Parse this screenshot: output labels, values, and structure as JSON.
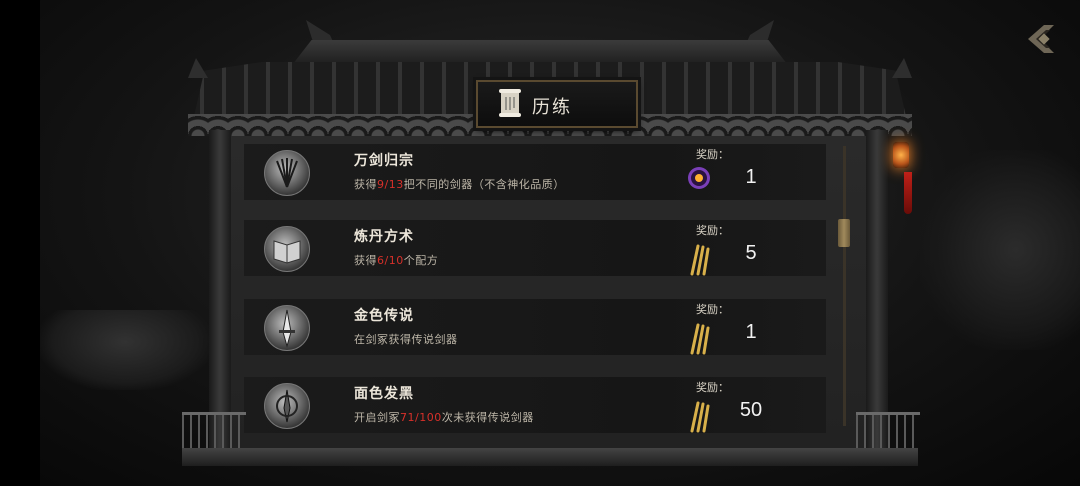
{
  "header": {
    "title": "历练"
  },
  "rewards_label": "奖励：",
  "achievements": [
    {
      "name": "万剑归宗",
      "desc_pre": "获得",
      "desc_hl": "9/13",
      "desc_post": "把不同的剑器（不含神化品质）",
      "reward_icon": "purple-orb-icon",
      "reward_amount": "1"
    },
    {
      "name": "炼丹方术",
      "desc_pre": "获得",
      "desc_hl": "6/10",
      "desc_post": "个配方",
      "reward_icon": "gold-swords-icon",
      "reward_amount": "5"
    },
    {
      "name": "金色传说",
      "desc_pre": "在剑冢获得传说剑器",
      "desc_hl": "",
      "desc_post": "",
      "reward_icon": "gold-swords-icon",
      "reward_amount": "1"
    },
    {
      "name": "面色发黑",
      "desc_pre": "开启剑冢",
      "desc_hl": "71/100",
      "desc_post": "次未获得传说剑器",
      "reward_icon": "gold-swords-icon",
      "reward_amount": "50"
    }
  ],
  "colors": {
    "highlight": "#d6302a",
    "gold": "#c9a44a",
    "panel": "#222222"
  },
  "icons": {
    "back": "back-arrow-icon",
    "title": "scroll-icon"
  }
}
